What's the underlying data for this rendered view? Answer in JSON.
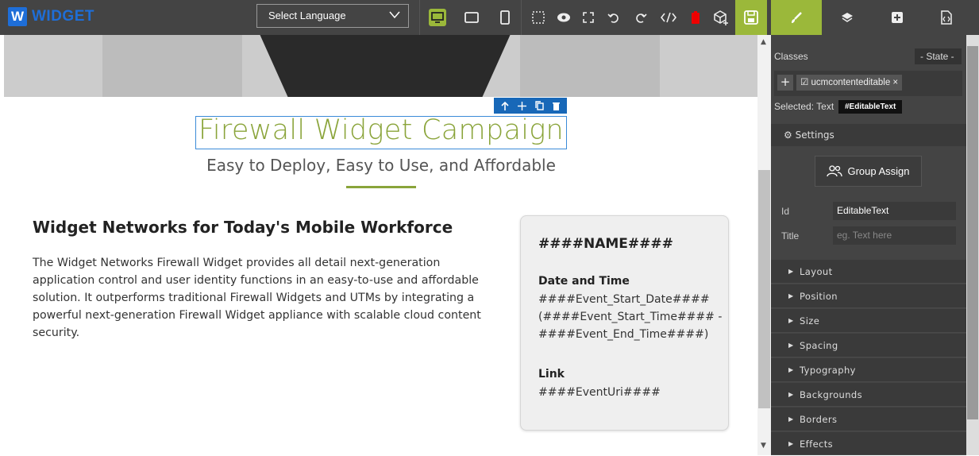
{
  "app": {
    "logo_letter": "W",
    "logo_word": "WIDGET"
  },
  "toolbar": {
    "language_select": "Select Language",
    "accent_color": "#9bb83a",
    "icons": [
      "desktop-icon",
      "tablet-icon",
      "mobile-icon",
      "outline-icon",
      "preview-icon",
      "fullscreen-icon",
      "undo-icon",
      "redo-icon",
      "code-icon",
      "trash-icon",
      "import-icon",
      "save-icon"
    ]
  },
  "panel_tabs": [
    "style-manager-icon",
    "layer-manager-icon",
    "blocks-icon",
    "settings-icon"
  ],
  "canvas": {
    "title": "Firewall Widget Campaign",
    "subtitle": "Easy to Deploy, Easy to Use, and Affordable",
    "heading": "Widget Networks for Today's Mobile Workforce",
    "paragraph": "The Widget Networks Firewall Widget provides all detail next-generation application control and user identity functions in an easy-to-use and affordable solution. It outperforms traditional Firewall Widgets and UTMs by integrating a powerful next-generation Firewall Widget appliance with scalable cloud content security.",
    "card": {
      "name": "####NAME####",
      "date_label": "Date and Time",
      "date_line1": "####Event_Start_Date####",
      "date_line2": "(####Event_Start_Time#### -",
      "date_line3": "####Event_End_Time####)",
      "link_label": "Link",
      "link_value": "####EventUri####"
    }
  },
  "style_panel": {
    "classes_label": "Classes",
    "state_label": "- State -",
    "add_label": "+",
    "class_tag": "☑ ucmcontenteditable ×",
    "selected_label": "Selected: Text",
    "selected_badge": "#EditableText",
    "settings_label": "⚙ Settings",
    "group_assign": "Group Assign",
    "id_label": "Id",
    "id_value": "EditableText",
    "title_label": "Title",
    "title_placeholder": "eg. Text here",
    "sections": [
      "Layout",
      "Position",
      "Size",
      "Spacing",
      "Typography",
      "Backgrounds",
      "Borders",
      "Effects"
    ]
  }
}
